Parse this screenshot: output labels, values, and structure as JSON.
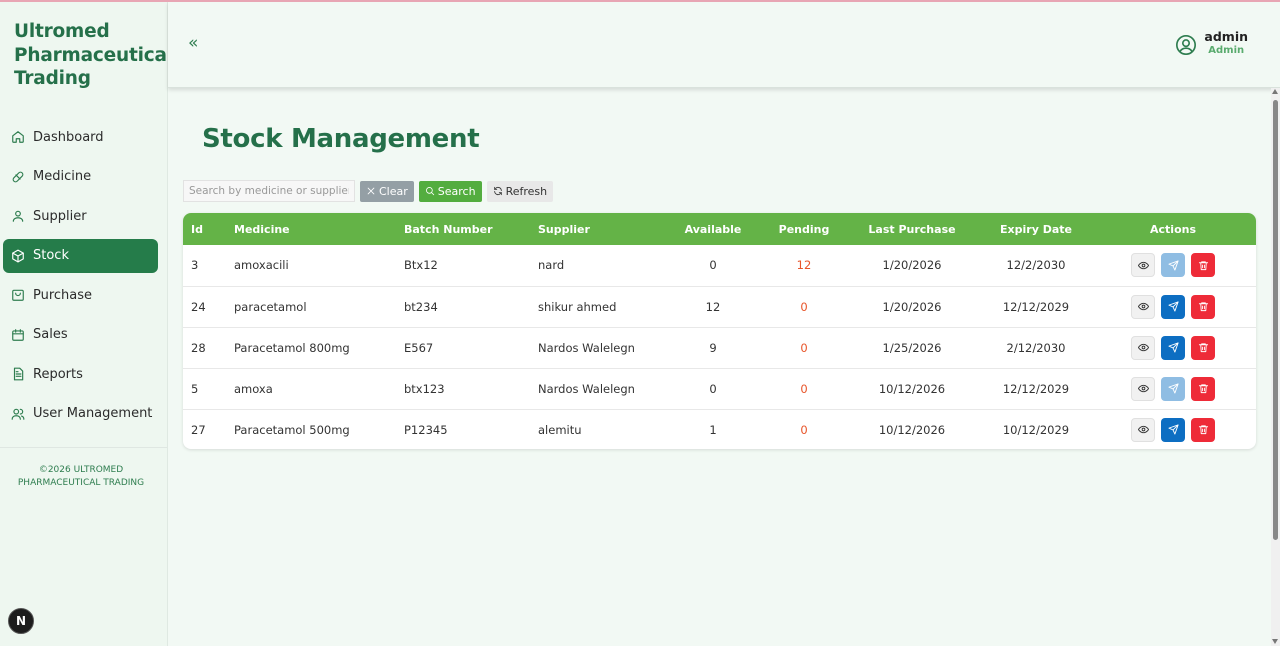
{
  "brand": {
    "name": "Ultromed Pharmaceutical Trading"
  },
  "sidebar": {
    "items": [
      {
        "label": "Dashboard",
        "icon": "home-icon",
        "active": false
      },
      {
        "label": "Medicine",
        "icon": "pill-icon",
        "active": false
      },
      {
        "label": "Supplier",
        "icon": "user-icon",
        "active": false
      },
      {
        "label": "Stock",
        "icon": "box-icon",
        "active": true
      },
      {
        "label": "Purchase",
        "icon": "bag-icon",
        "active": false
      },
      {
        "label": "Sales",
        "icon": "calendar-icon",
        "active": false
      },
      {
        "label": "Reports",
        "icon": "document-icon",
        "active": false
      },
      {
        "label": "User Management",
        "icon": "users-icon",
        "active": false
      }
    ],
    "copyright_line1": "©2026 ULTROMED",
    "copyright_line2": "PHARMACEUTICAL TRADING"
  },
  "header": {
    "collapse_glyph": "«",
    "user_name": "admin",
    "user_role": "Admin"
  },
  "main": {
    "title": "Stock Management",
    "search": {
      "placeholder": "Search by medicine or supplier",
      "value": ""
    },
    "buttons": {
      "clear": "Clear",
      "search": "Search",
      "refresh": "Refresh"
    }
  },
  "table": {
    "columns": [
      "Id",
      "Medicine",
      "Batch Number",
      "Supplier",
      "Available",
      "Pending",
      "Last Purchase",
      "Expiry Date",
      "Actions"
    ],
    "rows": [
      {
        "id": "3",
        "medicine": "amoxacili",
        "batch": "Btx12",
        "supplier": "nard",
        "available": "0",
        "pending": "12",
        "last_purchase": "1/20/2026",
        "expiry": "12/2/2030",
        "send_enabled": false
      },
      {
        "id": "24",
        "medicine": "paracetamol",
        "batch": "bt234",
        "supplier": "shikur ahmed",
        "available": "12",
        "pending": "0",
        "last_purchase": "1/20/2026",
        "expiry": "12/12/2029",
        "send_enabled": true
      },
      {
        "id": "28",
        "medicine": "Paracetamol 800mg",
        "batch": "E567",
        "supplier": "Nardos Walelegn",
        "available": "9",
        "pending": "0",
        "last_purchase": "1/25/2026",
        "expiry": "2/12/2030",
        "send_enabled": true
      },
      {
        "id": "5",
        "medicine": "amoxa",
        "batch": "btx123",
        "supplier": "Nardos Walelegn",
        "available": "0",
        "pending": "0",
        "last_purchase": "10/12/2026",
        "expiry": "12/12/2029",
        "send_enabled": false
      },
      {
        "id": "27",
        "medicine": "Paracetamol 500mg",
        "batch": "P12345",
        "supplier": "alemitu",
        "available": "1",
        "pending": "0",
        "last_purchase": "10/12/2026",
        "expiry": "10/12/2029",
        "send_enabled": true
      }
    ]
  },
  "dev_badge": "N",
  "colors": {
    "brand_green": "#25704a",
    "table_header": "#64b347",
    "active_nav": "#257c4a",
    "pending": "#e8552a",
    "send": "#0d6ec2",
    "delete": "#ee2b38"
  }
}
